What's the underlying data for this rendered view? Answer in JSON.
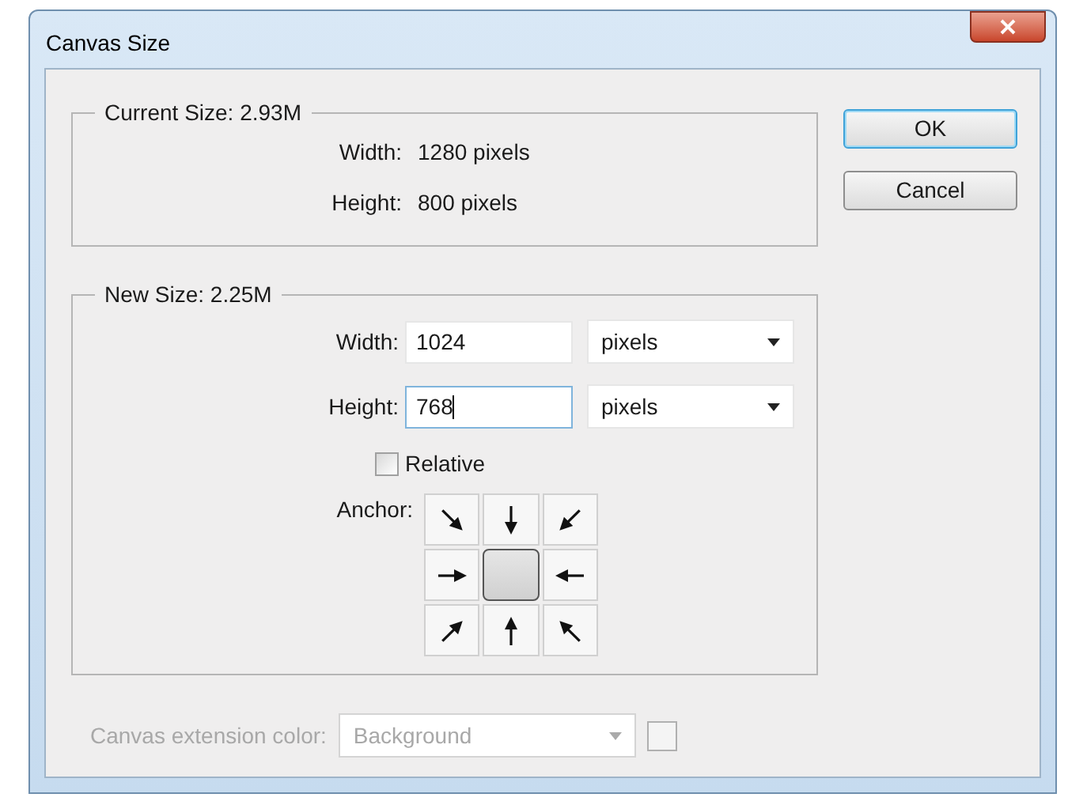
{
  "window": {
    "title": "Canvas Size"
  },
  "current_size": {
    "legend": "Current Size: 2.93M",
    "rows": [
      {
        "label": "Width:",
        "value": "1280 pixels"
      },
      {
        "label": "Height:",
        "value": "800 pixels"
      }
    ]
  },
  "new_size": {
    "legend": "New Size: 2.25M",
    "fields": [
      {
        "label": "Width:",
        "value": "1024",
        "unit": "pixels",
        "focused": false
      },
      {
        "label": "Height:",
        "value": "768",
        "unit": "pixels",
        "focused": true
      }
    ],
    "relative": {
      "label": "Relative",
      "checked": false
    },
    "anchor": {
      "label": "Anchor:",
      "cells": [
        {
          "selected": false
        },
        {
          "selected": false
        },
        {
          "selected": false
        },
        {
          "selected": false
        },
        {
          "selected": true
        },
        {
          "selected": false
        },
        {
          "selected": false
        },
        {
          "selected": false
        },
        {
          "selected": false
        }
      ]
    }
  },
  "extension_color": {
    "label": "Canvas extension color:",
    "value": "Background",
    "disabled": true
  },
  "buttons": [
    {
      "label": "OK",
      "default": true
    },
    {
      "label": "Cancel",
      "default": false
    }
  ]
}
